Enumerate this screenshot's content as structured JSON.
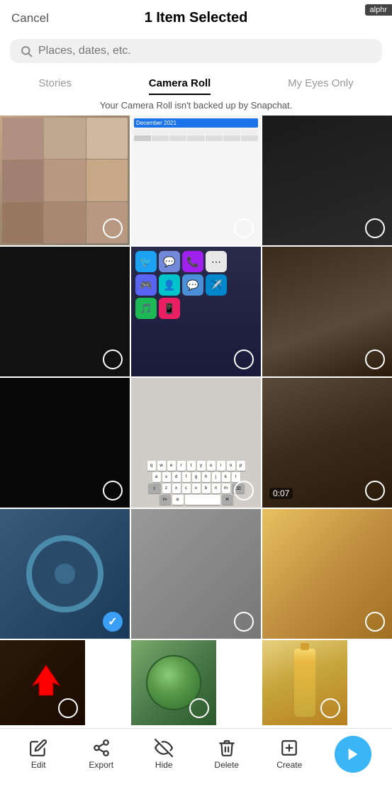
{
  "header": {
    "cancel_label": "Cancel",
    "title": "1 Item Selected",
    "badge": "alphr"
  },
  "search": {
    "placeholder": "Places, dates, etc."
  },
  "tabs": [
    {
      "id": "stories",
      "label": "Stories",
      "active": false
    },
    {
      "id": "camera-roll",
      "label": "Camera Roll",
      "active": true
    },
    {
      "id": "my-eyes-only",
      "label": "My Eyes Only",
      "active": false
    }
  ],
  "notice": "Your Camera Roll isn't backed up by Snapchat.",
  "toolbar": {
    "edit_label": "Edit",
    "export_label": "Export",
    "hide_label": "Hide",
    "delete_label": "Delete",
    "create_label": "Create"
  },
  "grid": {
    "cells": [
      {
        "id": 0,
        "type": "photo",
        "selected": false,
        "duration": null,
        "bg": "#c8b4a0"
      },
      {
        "id": 1,
        "type": "photo",
        "selected": false,
        "duration": null,
        "bg": "#e0d8d0"
      },
      {
        "id": 2,
        "type": "photo",
        "selected": false,
        "duration": null,
        "bg": "#1a1a1a"
      },
      {
        "id": 3,
        "type": "photo",
        "selected": false,
        "duration": null,
        "bg": "#111"
      },
      {
        "id": 4,
        "type": "photo",
        "selected": false,
        "duration": null,
        "bg": "#222"
      },
      {
        "id": 5,
        "type": "photo",
        "selected": false,
        "duration": null,
        "bg": "#4a3a2a"
      },
      {
        "id": 6,
        "type": "photo",
        "selected": false,
        "duration": null,
        "bg": "#0a0a0a"
      },
      {
        "id": 7,
        "type": "screenshot",
        "selected": false,
        "duration": null,
        "bg": "#667eea"
      },
      {
        "id": 8,
        "type": "video",
        "selected": false,
        "duration": "0:07",
        "bg": "#4a3a2a"
      },
      {
        "id": 9,
        "type": "photo",
        "selected": true,
        "duration": null,
        "bg": "#3a6a8a"
      },
      {
        "id": 10,
        "type": "photo",
        "selected": false,
        "duration": null,
        "bg": "#888"
      },
      {
        "id": 11,
        "type": "photo",
        "selected": false,
        "duration": null,
        "bg": "#d4a060"
      },
      {
        "id": 12,
        "type": "photo",
        "selected": false,
        "duration": null,
        "bg": "#2a1a0a"
      },
      {
        "id": 13,
        "type": "photo",
        "selected": false,
        "duration": null,
        "bg": "#8aaa7a"
      },
      {
        "id": 14,
        "type": "photo",
        "selected": false,
        "duration": null,
        "bg": "#e8d090"
      }
    ]
  }
}
